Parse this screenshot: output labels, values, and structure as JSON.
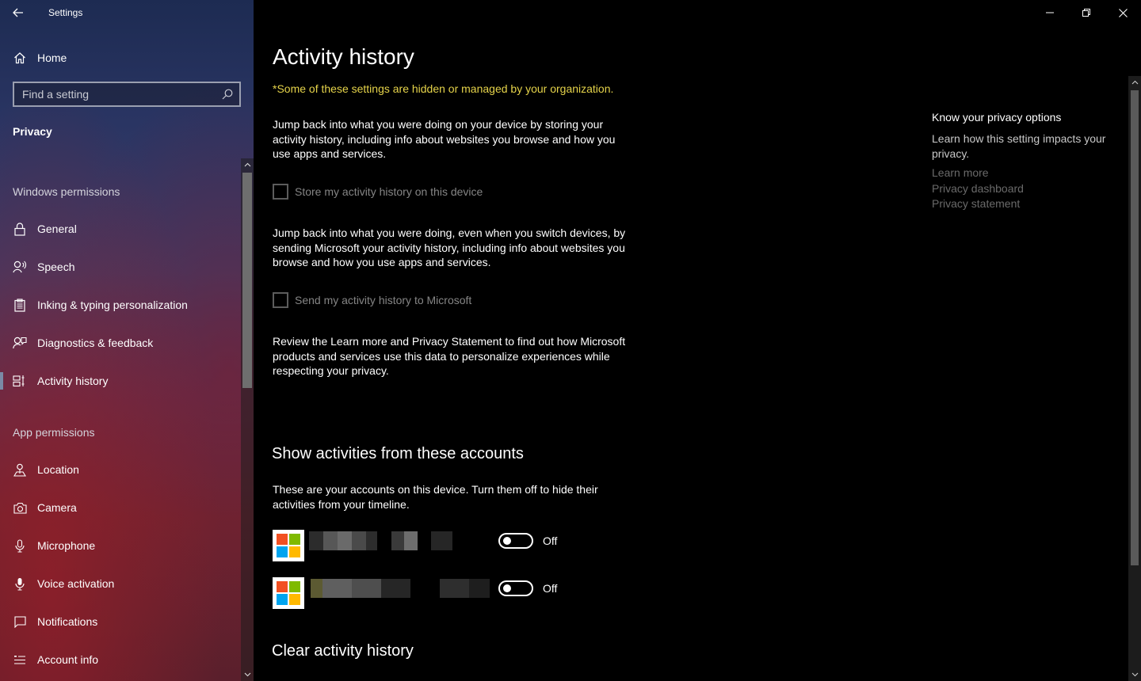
{
  "app": {
    "title": "Settings"
  },
  "sidebar": {
    "home_label": "Home",
    "search_placeholder": "Find a setting",
    "category": "Privacy",
    "windows_permissions_title": "Windows permissions",
    "windows_permissions": [
      {
        "label": "General",
        "icon": "lock-icon"
      },
      {
        "label": "Speech",
        "icon": "speech-icon"
      },
      {
        "label": "Inking & typing personalization",
        "icon": "clipboard-icon"
      },
      {
        "label": "Diagnostics & feedback",
        "icon": "feedback-icon"
      },
      {
        "label": "Activity history",
        "icon": "timeline-icon",
        "selected": true
      }
    ],
    "app_permissions_title": "App permissions",
    "app_permissions": [
      {
        "label": "Location",
        "icon": "location-icon"
      },
      {
        "label": "Camera",
        "icon": "camera-icon"
      },
      {
        "label": "Microphone",
        "icon": "microphone-icon"
      },
      {
        "label": "Voice activation",
        "icon": "voice-activation-icon"
      },
      {
        "label": "Notifications",
        "icon": "notifications-icon"
      },
      {
        "label": "Account info",
        "icon": "account-info-icon"
      }
    ]
  },
  "main": {
    "title": "Activity history",
    "managed_notice": "*Some of these settings are hidden or managed by your organization.",
    "para1": "Jump back into what you were doing on your device by storing your activity history, including info about websites you browse and how you use apps and services.",
    "check1": {
      "label": "Store my activity history on this device",
      "checked": false,
      "enabled": false
    },
    "para2": "Jump back into what you were doing, even when you switch devices, by sending Microsoft your activity history, including info about websites you browse and how you use apps and services.",
    "check2": {
      "label": "Send my activity history to Microsoft",
      "checked": false,
      "enabled": false
    },
    "para3": "Review the Learn more and Privacy Statement to find out how Microsoft products and services use this data to personalize experiences while respecting your privacy.",
    "accounts_title": "Show activities from these accounts",
    "accounts_desc": "These are your accounts on this device. Turn them off to hide their activities from your timeline.",
    "accounts": [
      {
        "toggle_label": "Off",
        "on": false
      },
      {
        "toggle_label": "Off",
        "on": false
      }
    ],
    "clear_title": "Clear activity history"
  },
  "privacy_options": {
    "title": "Know your privacy options",
    "desc": "Learn how this setting impacts your privacy.",
    "links": [
      "Learn more",
      "Privacy dashboard",
      "Privacy statement"
    ]
  },
  "colors": {
    "managed_notice": "#e5d34a",
    "ms_red": "#f25022",
    "ms_green": "#7fba00",
    "ms_blue": "#00a4ef",
    "ms_yellow": "#ffb900"
  }
}
